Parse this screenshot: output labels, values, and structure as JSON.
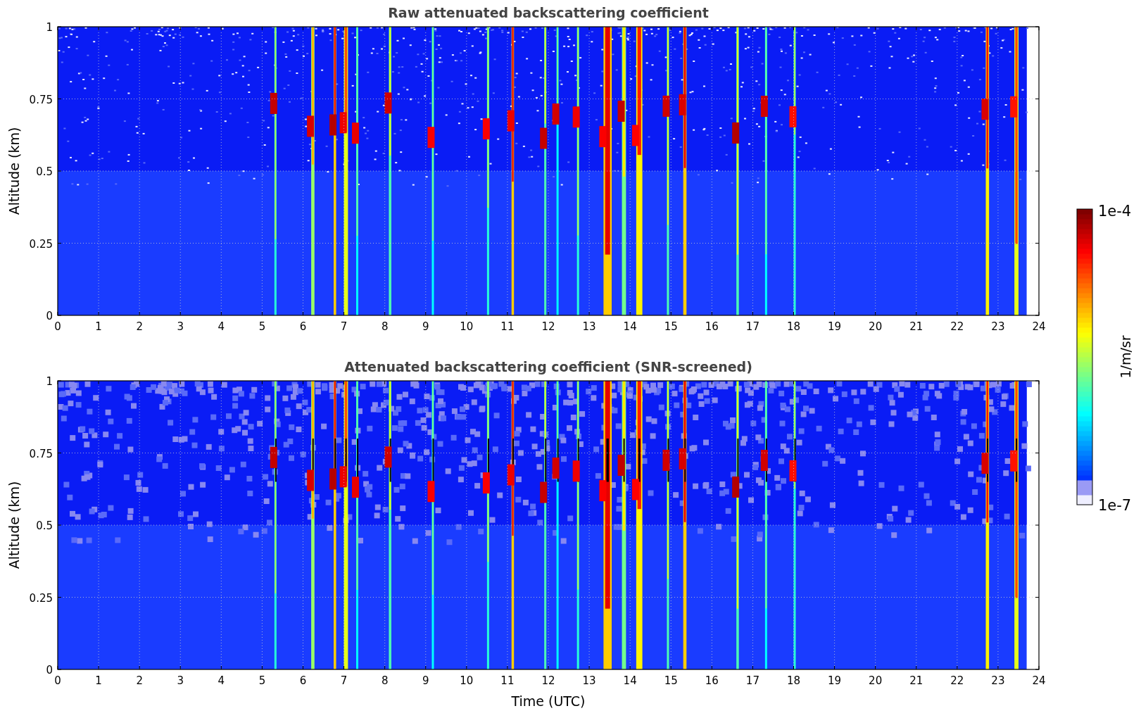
{
  "panels": [
    {
      "title": "Raw attenuated backscattering coefficient",
      "ylabel": "Altitude (km)",
      "screened": false,
      "yticks": [
        "1",
        "0.75",
        "0.5",
        "0.25",
        "0"
      ],
      "xticks": [
        "0",
        "1",
        "2",
        "3",
        "4",
        "5",
        "6",
        "7",
        "8",
        "9",
        "10",
        "11",
        "12",
        "13",
        "14",
        "15",
        "16",
        "17",
        "18",
        "19",
        "20",
        "21",
        "22",
        "23",
        "24"
      ]
    },
    {
      "title": "Attenuated backscattering coefficient (SNR-screened)",
      "ylabel": "Altitude (km)",
      "screened": true,
      "yticks": [
        "1",
        "0.75",
        "0.5",
        "0.25",
        "0"
      ],
      "xticks": [
        "0",
        "1",
        "2",
        "3",
        "4",
        "5",
        "6",
        "7",
        "8",
        "9",
        "10",
        "11",
        "12",
        "13",
        "14",
        "15",
        "16",
        "17",
        "18",
        "19",
        "20",
        "21",
        "22",
        "23",
        "24"
      ],
      "xlabel": "Time (UTC)"
    }
  ],
  "colorbar": {
    "max_label": "1e-4",
    "min_label": "1e-7",
    "unit_label": "1/m/sr"
  }
}
